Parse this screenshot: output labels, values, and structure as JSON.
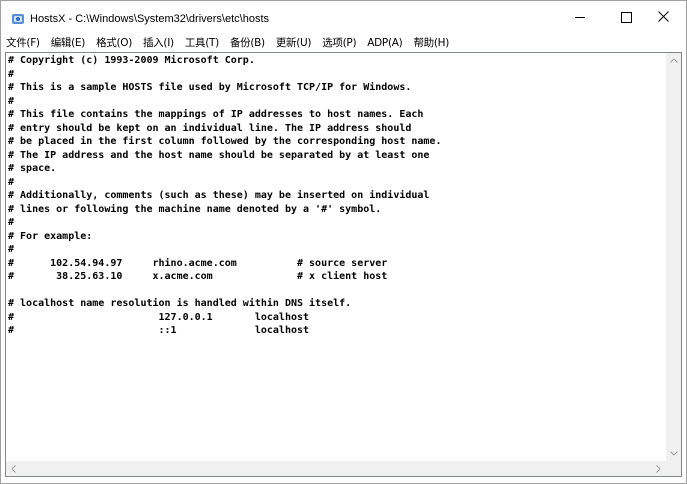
{
  "window": {
    "title": "HostsX - C:\\Windows\\System32\\drivers\\etc\\hosts",
    "app_icon": "hostsx-app-icon"
  },
  "menu": [
    {
      "label": "文件(F)"
    },
    {
      "label": "编辑(E)"
    },
    {
      "label": "格式(O)"
    },
    {
      "label": "插入(I)"
    },
    {
      "label": "工具(T)"
    },
    {
      "label": "备份(B)"
    },
    {
      "label": "更新(U)"
    },
    {
      "label": "选项(P)"
    },
    {
      "label": "ADP(A)"
    },
    {
      "label": "帮助(H)"
    }
  ],
  "editor": {
    "lines": [
      "# Copyright (c) 1993-2009 Microsoft Corp.",
      "#",
      "# This is a sample HOSTS file used by Microsoft TCP/IP for Windows.",
      "#",
      "# This file contains the mappings of IP addresses to host names. Each",
      "# entry should be kept on an individual line. The IP address should",
      "# be placed in the first column followed by the corresponding host name.",
      "# The IP address and the host name should be separated by at least one",
      "# space.",
      "#",
      "# Additionally, comments (such as these) may be inserted on individual",
      "# lines or following the machine name denoted by a '#' symbol.",
      "#",
      "# For example:",
      "#",
      "#      102.54.94.97     rhino.acme.com          # source server",
      "#       38.25.63.10     x.acme.com              # x client host",
      "",
      "# localhost name resolution is handled within DNS itself.",
      "#                        127.0.0.1       localhost",
      "#                        ::1             localhost"
    ]
  }
}
